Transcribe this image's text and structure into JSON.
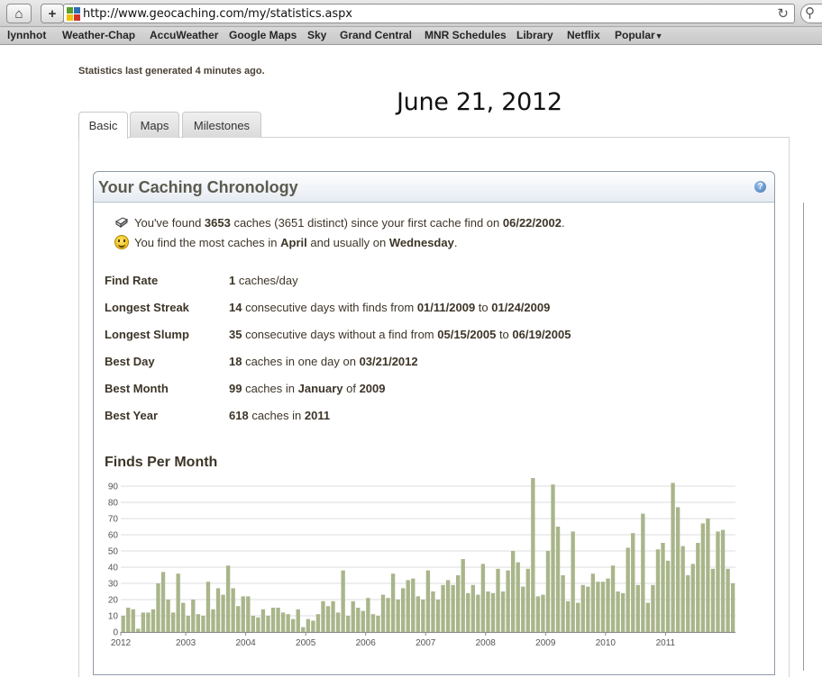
{
  "browser": {
    "url": "http://www.geocaching.com/my/statistics.aspx",
    "bookmarks": [
      "lynnhot",
      "Weather-Chap",
      "AccuWeather",
      "Google Maps",
      "Sky",
      "Grand Central",
      "MNR Schedules",
      "Library",
      "Netflix",
      "Popular"
    ]
  },
  "page": {
    "generated_note": "Statistics last generated 4 minutes ago.",
    "date_overlay": "June 21, 2012",
    "tabs": [
      "Basic",
      "Maps",
      "Milestones"
    ],
    "active_tab": "Basic"
  },
  "chronology": {
    "title": "Your Caching Chronology",
    "summary1": {
      "p1": "You've found ",
      "found": "3653",
      "p2": " caches (3651 distinct) since your first cache find on ",
      "first_date": "06/22/2002",
      "p3": "."
    },
    "summary2": {
      "p1": "You find the most caches in ",
      "month": "April",
      "p2": " and usually on ",
      "day": "Wednesday",
      "p3": "."
    },
    "stats": [
      {
        "label": "Find Rate",
        "parts": [
          {
            "t": "1",
            "b": true
          },
          {
            "t": " caches/day",
            "b": false
          }
        ]
      },
      {
        "label": "Longest Streak",
        "parts": [
          {
            "t": "14",
            "b": true
          },
          {
            "t": " consecutive days with finds from ",
            "b": false
          },
          {
            "t": "01/11/2009",
            "b": true
          },
          {
            "t": " to ",
            "b": false
          },
          {
            "t": "01/24/2009",
            "b": true
          }
        ]
      },
      {
        "label": "Longest Slump",
        "parts": [
          {
            "t": "35",
            "b": true
          },
          {
            "t": " consecutive days without a find from ",
            "b": false
          },
          {
            "t": "05/15/2005",
            "b": true
          },
          {
            "t": " to ",
            "b": false
          },
          {
            "t": "06/19/2005",
            "b": true
          }
        ]
      },
      {
        "label": "Best Day",
        "parts": [
          {
            "t": "18",
            "b": true
          },
          {
            "t": " caches in one day on ",
            "b": false
          },
          {
            "t": "03/21/2012",
            "b": true
          }
        ]
      },
      {
        "label": "Best Month",
        "parts": [
          {
            "t": "99",
            "b": true
          },
          {
            "t": " caches in ",
            "b": false
          },
          {
            "t": "January",
            "b": true
          },
          {
            "t": " of ",
            "b": false
          },
          {
            "t": "2009",
            "b": true
          }
        ]
      },
      {
        "label": "Best Year",
        "parts": [
          {
            "t": "618",
            "b": true
          },
          {
            "t": " caches in ",
            "b": false
          },
          {
            "t": "2011",
            "b": true
          }
        ]
      }
    ]
  },
  "chart_data": {
    "type": "bar",
    "title": "Finds Per Month",
    "xlabel": "",
    "ylabel": "",
    "ylim": [
      0,
      95
    ],
    "yticks": [
      0,
      10,
      20,
      30,
      40,
      50,
      60,
      70,
      80,
      90
    ],
    "grid": true,
    "bar_color": "#a9b58a",
    "x_tick_labels": [
      "2003",
      "2004",
      "2005",
      "2006",
      "2007",
      "2008",
      "2009",
      "2010",
      "2011",
      "2012"
    ],
    "categories": [
      "2002-06",
      "2002-07",
      "2002-08",
      "2002-09",
      "2002-10",
      "2002-11",
      "2002-12",
      "2003-01",
      "2003-02",
      "2003-03",
      "2003-04",
      "2003-05",
      "2003-06",
      "2003-07",
      "2003-08",
      "2003-09",
      "2003-10",
      "2003-11",
      "2003-12",
      "2004-01",
      "2004-02",
      "2004-03",
      "2004-04",
      "2004-05",
      "2004-06",
      "2004-07",
      "2004-08",
      "2004-09",
      "2004-10",
      "2004-11",
      "2004-12",
      "2005-01",
      "2005-02",
      "2005-03",
      "2005-04",
      "2005-05",
      "2005-06",
      "2005-07",
      "2005-08",
      "2005-09",
      "2005-10",
      "2005-11",
      "2005-12",
      "2006-01",
      "2006-02",
      "2006-03",
      "2006-04",
      "2006-05",
      "2006-06",
      "2006-07",
      "2006-08",
      "2006-09",
      "2006-10",
      "2006-11",
      "2006-12",
      "2007-01",
      "2007-02",
      "2007-03",
      "2007-04",
      "2007-05",
      "2007-06",
      "2007-07",
      "2007-08",
      "2007-09",
      "2007-10",
      "2007-11",
      "2007-12",
      "2008-01",
      "2008-02",
      "2008-03",
      "2008-04",
      "2008-05",
      "2008-06",
      "2008-07",
      "2008-08",
      "2008-09",
      "2008-10",
      "2008-11",
      "2008-12",
      "2009-01",
      "2009-02",
      "2009-03",
      "2009-04",
      "2009-05",
      "2009-06",
      "2009-07",
      "2009-08",
      "2009-09",
      "2009-10",
      "2009-11",
      "2009-12",
      "2010-01",
      "2010-02",
      "2010-03",
      "2010-04",
      "2010-05",
      "2010-06",
      "2010-07",
      "2010-08",
      "2010-09",
      "2010-10",
      "2010-11",
      "2010-12",
      "2011-01",
      "2011-02",
      "2011-03",
      "2011-04",
      "2011-05",
      "2011-06",
      "2011-07",
      "2011-08",
      "2011-09",
      "2011-10",
      "2011-11",
      "2011-12",
      "2012-01",
      "2012-02",
      "2012-03",
      "2012-04",
      "2012-05",
      "2012-06"
    ],
    "values": [
      10,
      15,
      14,
      2,
      12,
      12,
      14,
      30,
      37,
      20,
      12,
      36,
      18,
      10,
      20,
      11,
      10,
      31,
      14,
      27,
      23,
      41,
      27,
      16,
      22,
      22,
      10,
      9,
      14,
      10,
      15,
      15,
      12,
      11,
      8,
      14,
      3,
      8,
      7,
      11,
      19,
      16,
      19,
      12,
      38,
      10,
      19,
      15,
      13,
      21,
      11,
      10,
      23,
      21,
      36,
      20,
      27,
      32,
      33,
      22,
      20,
      38,
      25,
      20,
      29,
      32,
      29,
      35,
      45,
      24,
      29,
      23,
      42,
      25,
      24,
      39,
      25,
      38,
      50,
      43,
      28,
      39,
      99,
      22,
      23,
      50,
      91,
      65,
      35,
      19,
      62,
      18,
      29,
      28,
      36,
      31,
      31,
      33,
      41,
      25,
      24,
      52,
      61,
      29,
      73,
      18,
      29,
      51,
      55,
      44,
      92,
      77,
      53,
      35,
      42,
      55,
      67,
      70,
      39,
      62,
      63,
      39,
      30
    ]
  }
}
